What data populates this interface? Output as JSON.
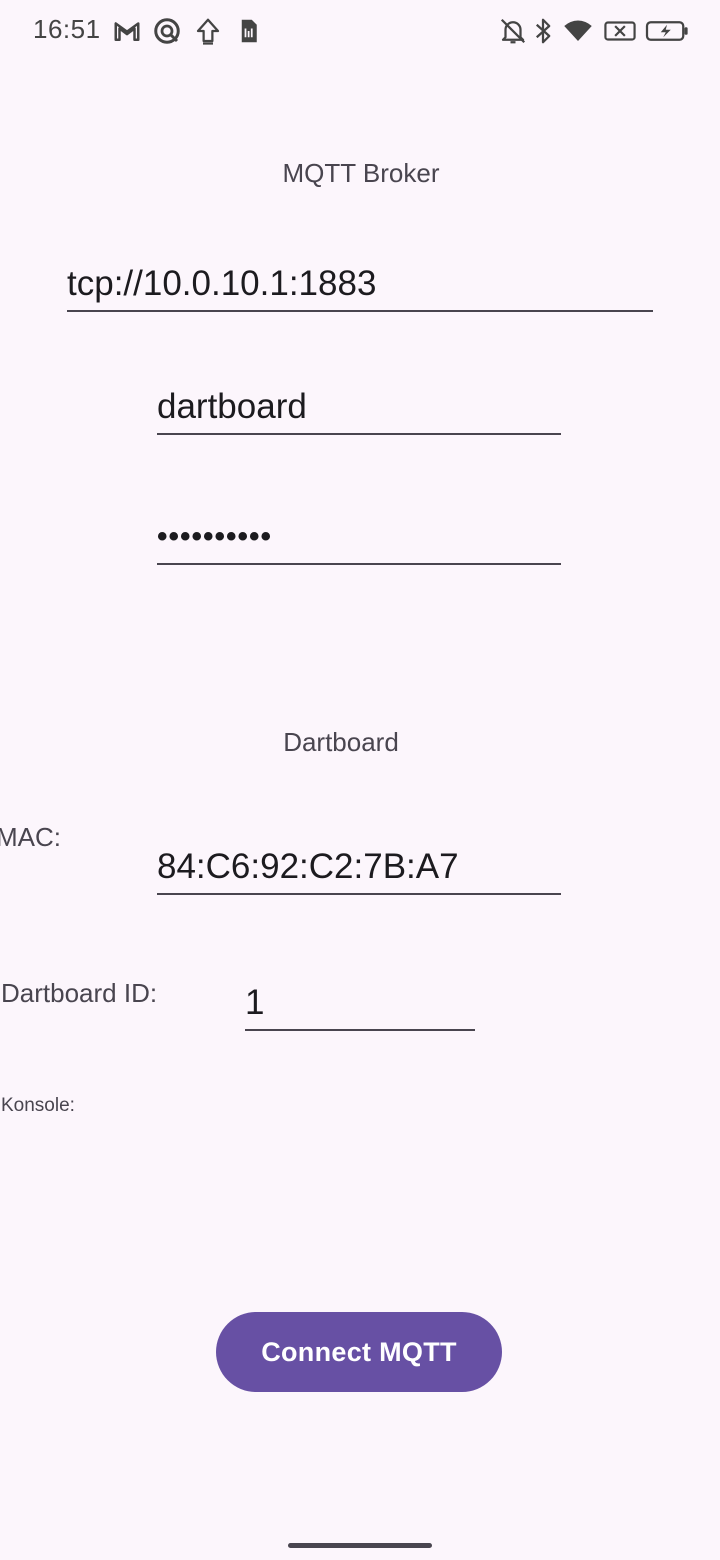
{
  "status_bar": {
    "time": "16:51",
    "left_icons": [
      "gmail-icon",
      "vpn-icon",
      "upload-icon",
      "sim-card-icon"
    ],
    "right_icons": [
      "notifications-off-icon",
      "bluetooth-icon",
      "wifi-icon",
      "no-signal-icon",
      "battery-charging-icon"
    ]
  },
  "mqtt_broker": {
    "title": "MQTT Broker",
    "url_value": "tcp://10.0.10.1:1883",
    "username_value": "dartboard",
    "password_value": "••••••••••"
  },
  "dartboard": {
    "title": "Dartboard",
    "mac_label": "MAC:",
    "mac_value": "84:C6:92:C2:7B:A7",
    "id_label": "Dartboard ID:",
    "id_value": "1"
  },
  "console": {
    "label": "Konsole:"
  },
  "actions": {
    "connect_label": "Connect MQTT"
  },
  "colors": {
    "background": "#fcf6fc",
    "primary": "#6750a4",
    "on_primary": "#ffffff",
    "text": "#1c1b1f",
    "secondary_text": "#49454f"
  }
}
